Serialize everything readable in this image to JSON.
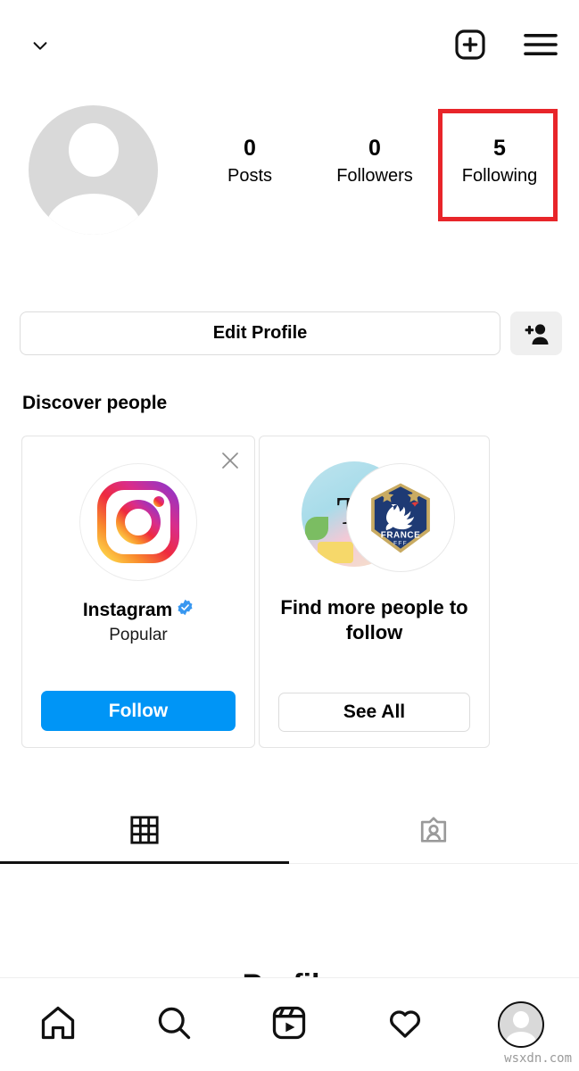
{
  "topbar": {
    "username": "",
    "chevron_icon": "chevron-down-icon",
    "new_post_icon": "plus-square-icon",
    "menu_icon": "hamburger-menu-icon"
  },
  "profile": {
    "avatar_icon": "default-avatar-placeholder",
    "stats": [
      {
        "count": "0",
        "label": "Posts"
      },
      {
        "count": "0",
        "label": "Followers"
      },
      {
        "count": "5",
        "label": "Following"
      }
    ],
    "highlighted_stat": "Following",
    "highlight_color": "#e8252a",
    "edit_profile_label": "Edit Profile",
    "add_person_icon": "add-person-icon"
  },
  "discover": {
    "heading": "Discover people",
    "cards": [
      {
        "avatar_icon": "instagram-logo-icon",
        "name": "Instagram",
        "verified": true,
        "verified_icon": "verified-badge-icon",
        "subtitle": "Popular",
        "button_label": "Follow",
        "button_color": "#0095f6",
        "close_icon": "close-x-icon"
      },
      {
        "avatar_icon": "stacked-avatars-france-crest",
        "crest_country": "FRANCE",
        "crest_federation": "FFF",
        "title": "Find more people to follow",
        "button_label": "See All"
      }
    ]
  },
  "tabs": [
    {
      "name": "grid",
      "icon": "grid-icon",
      "active": true
    },
    {
      "name": "tagged",
      "icon": "tagged-person-icon",
      "active": false
    }
  ],
  "cut_heading": "Profile",
  "bottom_nav": [
    {
      "name": "home",
      "icon": "home-icon"
    },
    {
      "name": "search",
      "icon": "search-icon"
    },
    {
      "name": "reels",
      "icon": "reels-icon"
    },
    {
      "name": "activity",
      "icon": "heart-icon"
    },
    {
      "name": "profile",
      "icon": "profile-avatar-icon"
    }
  ],
  "watermark": "wsxdn.com"
}
